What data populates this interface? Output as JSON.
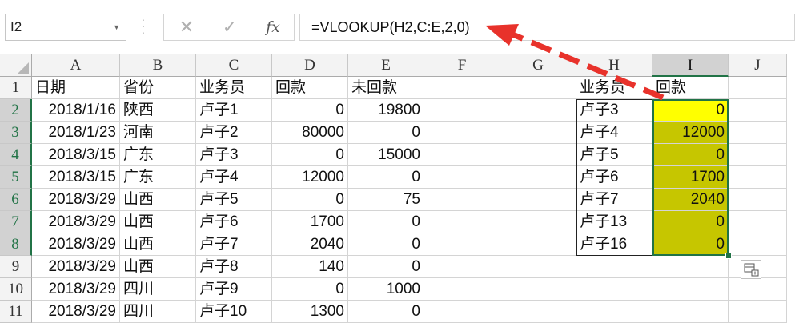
{
  "formula_bar": {
    "name_box": "I2",
    "cancel_icon": "✕",
    "enter_icon": "✓",
    "fx_label": "fx",
    "formula": "=VLOOKUP(H2,C:E,2,0)"
  },
  "columns": [
    "A",
    "B",
    "C",
    "D",
    "E",
    "F",
    "G",
    "H",
    "I",
    "J"
  ],
  "rows": [
    "1",
    "2",
    "3",
    "4",
    "5",
    "6",
    "7",
    "8",
    "9",
    "10",
    "11"
  ],
  "headers": {
    "A": "日期",
    "B": "省份",
    "C": "业务员",
    "D": "回款",
    "E": "未回款",
    "H": "业务员",
    "I": "回款"
  },
  "table": [
    [
      "2018/1/16",
      "陕西",
      "卢子1",
      "0",
      "19800"
    ],
    [
      "2018/1/23",
      "河南",
      "卢子2",
      "80000",
      "0"
    ],
    [
      "2018/3/15",
      "广东",
      "卢子3",
      "0",
      "15000"
    ],
    [
      "2018/3/15",
      "广东",
      "卢子4",
      "12000",
      "0"
    ],
    [
      "2018/3/29",
      "山西",
      "卢子5",
      "0",
      "75"
    ],
    [
      "2018/3/29",
      "山西",
      "卢子6",
      "1700",
      "0"
    ],
    [
      "2018/3/29",
      "山西",
      "卢子7",
      "2040",
      "0"
    ],
    [
      "2018/3/29",
      "山西",
      "卢子8",
      "140",
      "0"
    ],
    [
      "2018/3/29",
      "四川",
      "卢子9",
      "0",
      "1000"
    ],
    [
      "2018/3/29",
      "四川",
      "卢子10",
      "1300",
      "0"
    ]
  ],
  "lookup": [
    [
      "卢子3",
      "0"
    ],
    [
      "卢子4",
      "12000"
    ],
    [
      "卢子5",
      "0"
    ],
    [
      "卢子6",
      "1700"
    ],
    [
      "卢子7",
      "2040"
    ],
    [
      "卢子13",
      "0"
    ],
    [
      "卢子16",
      "0"
    ]
  ],
  "colors": {
    "highlight_active": "#ffff00",
    "highlight_range": "#c6c600",
    "arrow": "#e8322b",
    "selection": "#217346"
  }
}
